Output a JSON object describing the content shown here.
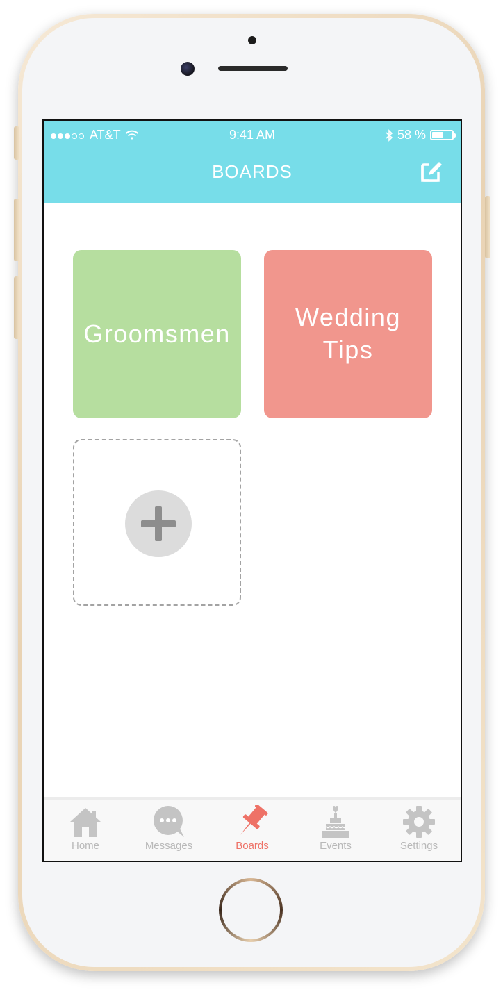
{
  "status_bar": {
    "carrier": "AT&T",
    "time": "9:41 AM",
    "battery": "58 %",
    "battery_level": 0.58,
    "signal_bars_filled": 3,
    "signal_bars_total": 5
  },
  "header": {
    "title": "BOARDS",
    "compose_icon": "edit-icon",
    "background_color": "#77dde9"
  },
  "boards": [
    {
      "title": "Groomsmen",
      "color": "#b6de9f"
    },
    {
      "title": "Wedding\nTips",
      "color": "#f1968d"
    }
  ],
  "add_board": {
    "icon": "plus-icon"
  },
  "tabbar": {
    "items": [
      {
        "label": "Home",
        "icon": "home-icon",
        "active": false
      },
      {
        "label": "Messages",
        "icon": "chat-icon",
        "active": false
      },
      {
        "label": "Boards",
        "icon": "pin-icon",
        "active": true
      },
      {
        "label": "Events",
        "icon": "cake-icon",
        "active": false
      },
      {
        "label": "Settings",
        "icon": "gear-icon",
        "active": false
      }
    ],
    "active_color": "#ee7267",
    "inactive_color": "#b9b9b9"
  }
}
